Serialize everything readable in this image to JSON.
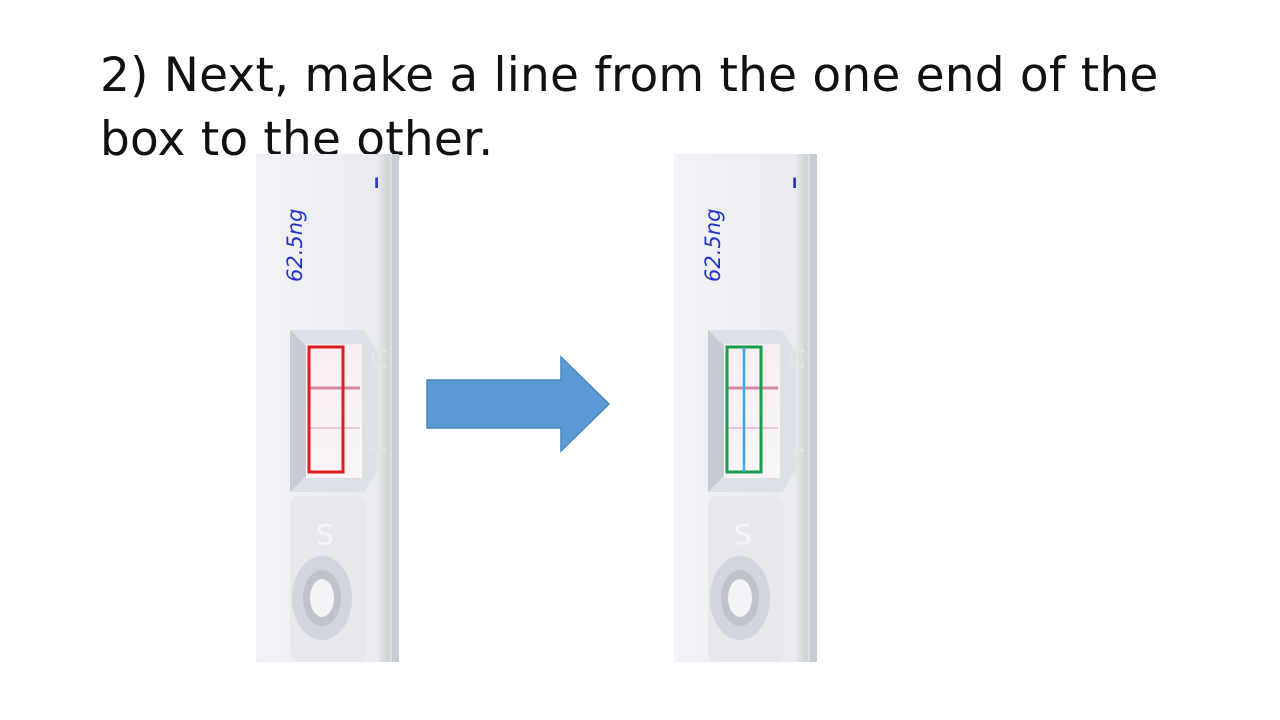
{
  "slide": {
    "title": "2)  Next, make a line from the one end of the box to the other."
  },
  "strips": [
    {
      "label": "62.5ng",
      "mark": "I",
      "control_letter": "C",
      "test_letter": "T",
      "sample_letter": "S",
      "box_color": "#e01e1e",
      "has_center_line": false
    },
    {
      "label": "62.5ng",
      "mark": "I",
      "control_letter": "C",
      "test_letter": "T",
      "sample_letter": "S",
      "box_color": "#14a04a",
      "line_color": "#3aa7e0",
      "has_center_line": true
    }
  ],
  "arrow": {
    "color": "#5b9bd5",
    "stroke": "#4a86bf",
    "direction": "right"
  }
}
